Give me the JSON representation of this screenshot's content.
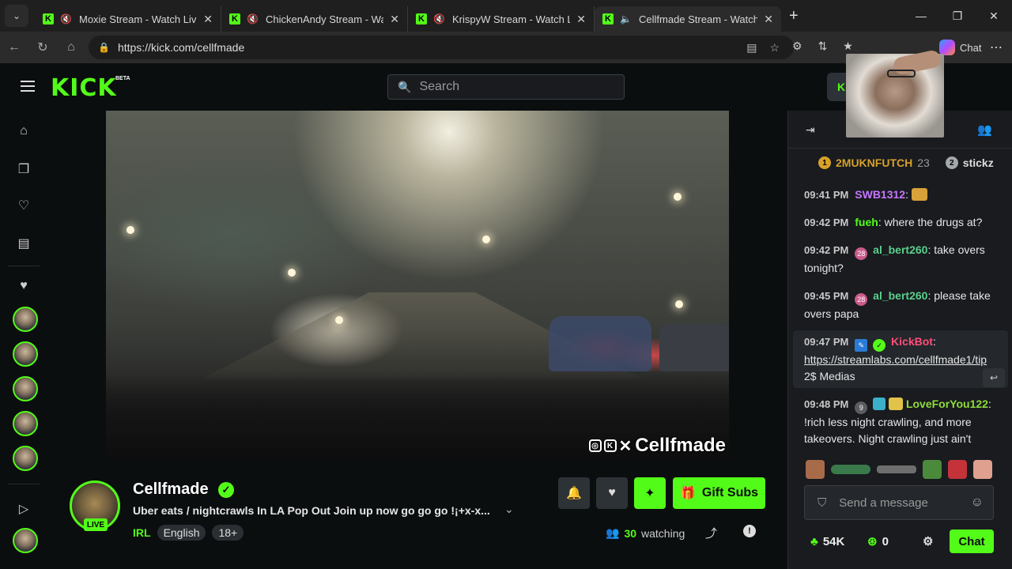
{
  "browser": {
    "tabs": [
      {
        "title": "Moxie Stream - Watch Live on",
        "active": false
      },
      {
        "title": "ChickenAndy Stream - Watch",
        "active": false
      },
      {
        "title": "KrispyW Stream - Watch Live",
        "active": false
      },
      {
        "title": "Cellfmade Stream - Watch Live",
        "active": true
      }
    ],
    "url": "https://kick.com/cellfmade",
    "chat_label": "Chat"
  },
  "header": {
    "logo": "KICK",
    "beta": "BETA",
    "search_placeholder": "Search"
  },
  "video": {
    "overlay_name": "Cellfmade"
  },
  "stream": {
    "name": "Cellfmade",
    "live_label": "LIVE",
    "title": "Uber eats / nightcrawls In LA Pop Out Join up now go go go !¡+x-x...",
    "category": "IRL",
    "tags": [
      "English",
      "18+"
    ],
    "gift_label": "Gift Subs",
    "viewers": "30",
    "watching_label": "watching"
  },
  "chat": {
    "pinned": [
      {
        "rank": "1",
        "name": "2MUKNFUTCH",
        "count": "23"
      },
      {
        "rank": "2",
        "name": "stickz"
      }
    ],
    "messages": [
      {
        "time": "09:41 PM",
        "user": "SWB1312",
        "text": "",
        "color": "#c676ff"
      },
      {
        "time": "09:42 PM",
        "user": "fueh",
        "text": "where the drugs at?",
        "color": "#53fc18"
      },
      {
        "time": "09:42 PM",
        "badge": "28",
        "user": "al_bert260",
        "text": "take overs tonight?",
        "color": "#5ad08c"
      },
      {
        "time": "09:45 PM",
        "badge": "28",
        "user": "al_bert260",
        "text": "please take overs papa",
        "color": "#5ad08c"
      },
      {
        "time": "09:47 PM",
        "user": "KickBot",
        "link": "https://streamlabs.com/cellfmade1/tip",
        "text": "2$ Medias",
        "color": "#ff4f7a"
      },
      {
        "time": "09:48 PM",
        "badge": "9",
        "user": "LoveForYou122",
        "text": "!rich less night crawling, and more takeovers. Night crawling just ain't",
        "color": "#8fdc3a"
      }
    ],
    "input_placeholder": "Send a message",
    "kicks": "54K",
    "points": "0",
    "send_label": "Chat"
  },
  "colors": {
    "brand": "#53fc18",
    "background": "#0b0e0f",
    "chat_bg": "#191b1f"
  }
}
